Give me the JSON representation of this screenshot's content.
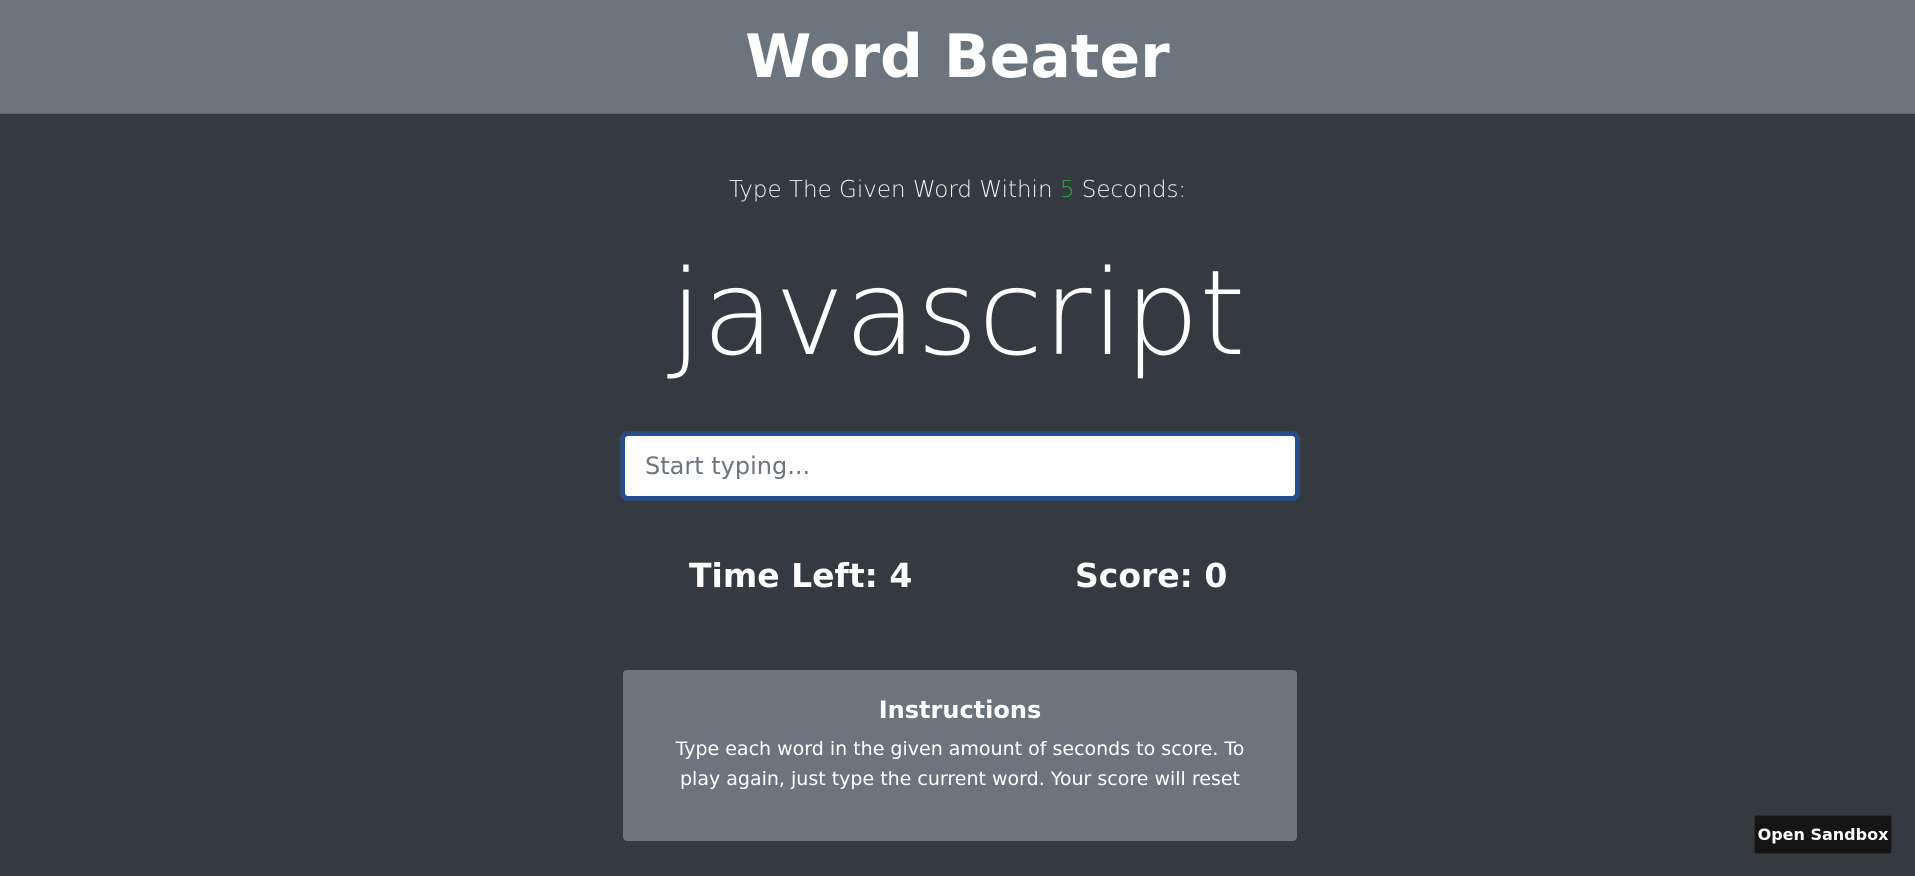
{
  "header": {
    "title": "Word Beater"
  },
  "prompt": {
    "prefix": "Type The Given Word Within ",
    "seconds": "5",
    "suffix": " Seconds:"
  },
  "game": {
    "current_word": "javascript",
    "input_placeholder": "Start typing...",
    "input_value": "",
    "time_left_label": "Time Left: ",
    "time_left_value": "4",
    "score_label": "Score: ",
    "score_value": "0"
  },
  "instructions": {
    "heading": "Instructions",
    "body": "Type each word in the given amount of seconds to score. To play again, just type the current word. Your score will reset"
  },
  "sandbox_button": {
    "label": "Open Sandbox"
  },
  "colors": {
    "background": "#343a40",
    "header_bg": "#6c757d",
    "seconds_accent": "#28a745",
    "input_focus_border": "#1f4f9c",
    "card_bg": "#6c757d",
    "sandbox_bg": "#151515"
  }
}
